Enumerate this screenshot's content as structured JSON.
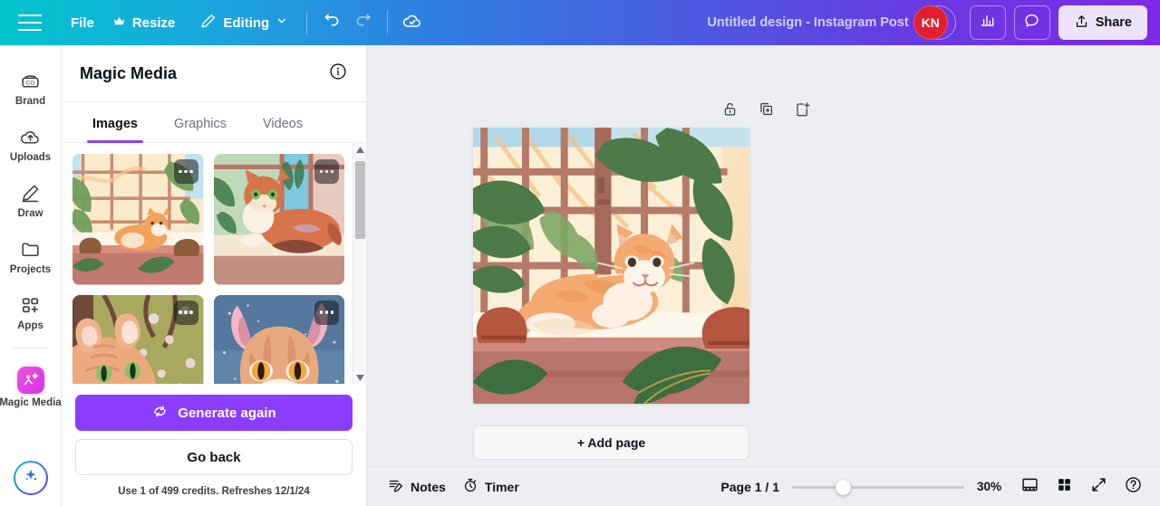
{
  "topbar": {
    "menu_icon": "hamburger-icon",
    "file_label": "File",
    "resize_label": "Resize",
    "resize_icon": "crown-icon",
    "editing_label": "Editing",
    "editing_icon": "pencil-icon",
    "chevron_icon": "chevron-down-icon",
    "undo_icon": "undo-icon",
    "redo_icon": "redo-icon",
    "cloud_icon": "cloud-saved-icon",
    "doc_title": "Untitled design - Instagram Post",
    "avatar_initials": "KN",
    "avatar_color": "#E01E2E",
    "add_person_label": "+",
    "insights_icon": "bar-chart-icon",
    "comment_icon": "comment-bubble-icon",
    "share_label": "Share",
    "share_icon": "upload-icon",
    "gradient_start": "#00C4CC",
    "gradient_end": "#7D2AE8"
  },
  "rail": {
    "items": [
      {
        "label": "Brand",
        "icon": "brand-icon"
      },
      {
        "label": "Uploads",
        "icon": "cloud-upload-icon"
      },
      {
        "label": "Draw",
        "icon": "pen-icon"
      },
      {
        "label": "Projects",
        "icon": "folder-icon"
      },
      {
        "label": "Apps",
        "icon": "apps-grid-plus-icon"
      }
    ],
    "active": {
      "label": "Magic Media",
      "icon": "magic-media-icon"
    },
    "spark_icon": "sparkle-icon"
  },
  "panel": {
    "title": "Magic Media",
    "info_icon": "info-icon",
    "tabs": [
      {
        "label": "Images",
        "active": true
      },
      {
        "label": "Graphics",
        "active": false
      },
      {
        "label": "Videos",
        "active": false
      }
    ],
    "thumbnails": [
      {
        "alt": "Orange tabby cat lying on a sunlit windowsill with plants",
        "menu_icon": "more-options-icon"
      },
      {
        "alt": "Orange and white cat resting on a wooden ledge by a window",
        "menu_icon": "more-options-icon"
      },
      {
        "alt": "Close-up of ginger cat face among green foliage and blossoms",
        "menu_icon": "more-options-icon"
      },
      {
        "alt": "Close-up portrait of a tabby cat against a starry blue background",
        "menu_icon": "more-options-icon"
      }
    ],
    "generate_label": "Generate again",
    "generate_icon": "refresh-icon",
    "goback_label": "Go back",
    "credits_note": "Use 1 of 499 credits. Refreshes 12/1/24",
    "accent_color": "#8B3DFF"
  },
  "canvas": {
    "tools": [
      {
        "icon": "unlock-icon",
        "name": "lock-page"
      },
      {
        "icon": "duplicate-icon",
        "name": "duplicate-page"
      },
      {
        "icon": "add-page-icon",
        "name": "add-page"
      }
    ],
    "artwork_alt": "Illustrated orange tabby cat lounging on a sunlit windowsill surrounded by houseplants",
    "add_page_label": "+ Add page"
  },
  "bottombar": {
    "notes_label": "Notes",
    "notes_icon": "notes-icon",
    "timer_label": "Timer",
    "timer_icon": "timer-icon",
    "page_indicator": "Page 1 / 1",
    "zoom_value": "30%",
    "presenter_icon": "presenter-view-icon",
    "grid_icon": "grid-view-icon",
    "fullscreen_icon": "fullscreen-icon",
    "help_icon": "help-icon"
  }
}
